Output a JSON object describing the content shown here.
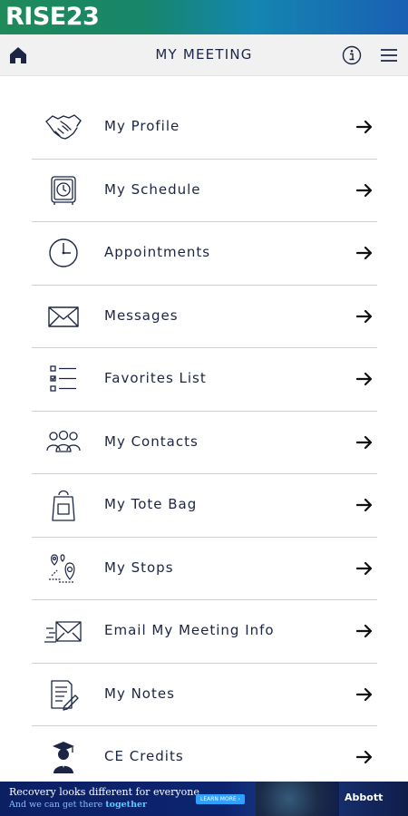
{
  "brand": {
    "logo_text": "RISE",
    "logo_year": "23"
  },
  "header": {
    "title": "MY MEETING",
    "icons": [
      "home-icon",
      "info-icon",
      "hamburger-menu-icon"
    ]
  },
  "menu_items": [
    {
      "label": "My Profile",
      "icon": "handshake-icon"
    },
    {
      "label": "My Schedule",
      "icon": "calendar-clock-icon"
    },
    {
      "label": "Appointments",
      "icon": "clock-icon"
    },
    {
      "label": "Messages",
      "icon": "envelope-icon"
    },
    {
      "label": "Favorites List",
      "icon": "checklist-icon"
    },
    {
      "label": "My Contacts",
      "icon": "people-group-icon"
    },
    {
      "label": "My Tote Bag",
      "icon": "tote-bag-icon"
    },
    {
      "label": "My Stops",
      "icon": "map-pins-icon"
    },
    {
      "label": "Email My Meeting Info",
      "icon": "email-send-icon"
    },
    {
      "label": "My Notes",
      "icon": "notes-icon"
    },
    {
      "label": "CE Credits",
      "icon": "graduate-icon"
    }
  ],
  "ad": {
    "line1": "Recovery looks different for everyone",
    "line2_prefix": "And we can get there ",
    "line2_emphasis": "together",
    "cta": "LEARN MORE ›",
    "brand": "Abbott"
  },
  "colors": {
    "text": "#1c2545",
    "divider": "#cfcfcf",
    "header_bg": "#f1f1f1"
  }
}
